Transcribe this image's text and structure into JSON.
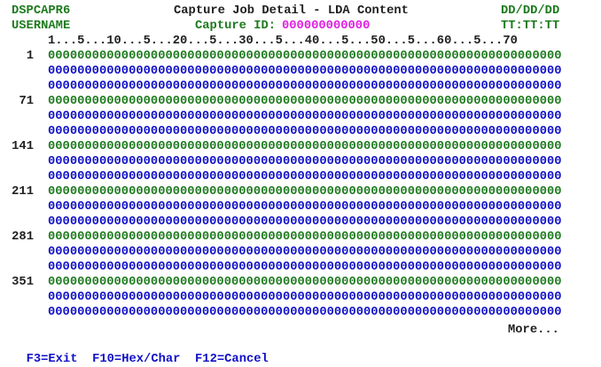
{
  "header": {
    "program": "DSPCAPR6",
    "title": "Capture Job Detail - LDA Content",
    "date": "DD/DD/DD",
    "user": "USERNAME",
    "capture_id_label": "Capture ID:",
    "capture_id_value": "000000000000",
    "time": "TT:TT:TT"
  },
  "ruler": "1...5...10...5...20...5...30...5...40...5...50...5...60...5...70",
  "rows": [
    {
      "offset": "1",
      "line": "0000000000000000000000000000000000000000000000000000000000000000000000",
      "color": "green"
    },
    {
      "offset": "",
      "line": "0000000000000000000000000000000000000000000000000000000000000000000000",
      "color": "blue"
    },
    {
      "offset": "",
      "line": "0000000000000000000000000000000000000000000000000000000000000000000000",
      "color": "blue"
    },
    {
      "offset": "71",
      "line": "0000000000000000000000000000000000000000000000000000000000000000000000",
      "color": "green"
    },
    {
      "offset": "",
      "line": "0000000000000000000000000000000000000000000000000000000000000000000000",
      "color": "blue"
    },
    {
      "offset": "",
      "line": "0000000000000000000000000000000000000000000000000000000000000000000000",
      "color": "blue"
    },
    {
      "offset": "141",
      "line": "0000000000000000000000000000000000000000000000000000000000000000000000",
      "color": "green"
    },
    {
      "offset": "",
      "line": "0000000000000000000000000000000000000000000000000000000000000000000000",
      "color": "blue"
    },
    {
      "offset": "",
      "line": "0000000000000000000000000000000000000000000000000000000000000000000000",
      "color": "blue"
    },
    {
      "offset": "211",
      "line": "0000000000000000000000000000000000000000000000000000000000000000000000",
      "color": "green"
    },
    {
      "offset": "",
      "line": "0000000000000000000000000000000000000000000000000000000000000000000000",
      "color": "blue"
    },
    {
      "offset": "",
      "line": "0000000000000000000000000000000000000000000000000000000000000000000000",
      "color": "blue"
    },
    {
      "offset": "281",
      "line": "0000000000000000000000000000000000000000000000000000000000000000000000",
      "color": "green"
    },
    {
      "offset": "",
      "line": "0000000000000000000000000000000000000000000000000000000000000000000000",
      "color": "blue"
    },
    {
      "offset": "",
      "line": "0000000000000000000000000000000000000000000000000000000000000000000000",
      "color": "blue"
    },
    {
      "offset": "351",
      "line": "0000000000000000000000000000000000000000000000000000000000000000000000",
      "color": "green"
    },
    {
      "offset": "",
      "line": "0000000000000000000000000000000000000000000000000000000000000000000000",
      "color": "blue"
    },
    {
      "offset": "",
      "line": "0000000000000000000000000000000000000000000000000000000000000000000000",
      "color": "blue"
    }
  ],
  "more": "More...",
  "function_keys": {
    "f3": "F3=Exit",
    "f10": "F10=Hex/Char",
    "f12": "F12=Cancel"
  },
  "colors": {
    "green": "#1e7b1e",
    "blue": "#1010c8",
    "magenta": "#e020e0",
    "background": "#ffffff"
  }
}
